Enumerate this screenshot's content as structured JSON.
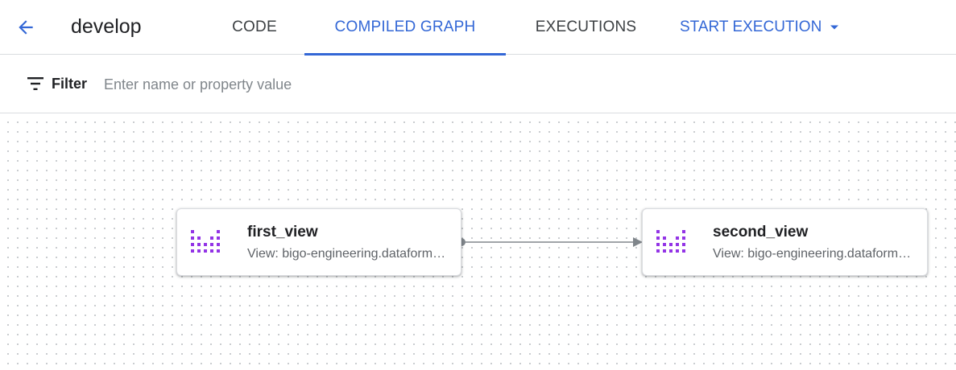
{
  "header": {
    "workspace_title": "develop",
    "tabs": [
      {
        "label": "CODE",
        "active": false
      },
      {
        "label": "COMPILED GRAPH",
        "active": true
      },
      {
        "label": "EXECUTIONS",
        "active": false
      }
    ],
    "start_execution_label": "START EXECUTION"
  },
  "filter": {
    "label": "Filter",
    "placeholder": "Enter name or property value",
    "value": ""
  },
  "graph": {
    "nodes": [
      {
        "name": "first_view",
        "subtitle": "View: bigo-engineering.dataform_staging.first_view",
        "icon": "view-table-icon"
      },
      {
        "name": "second_view",
        "subtitle": "View: bigo-engineering.dataform_staging.second_view",
        "icon": "view-table-icon"
      }
    ],
    "edges": [
      {
        "from": "first_view",
        "to": "second_view"
      }
    ]
  },
  "colors": {
    "accent": "#3367d6",
    "node_icon": "#9334e6",
    "edge": "#80868b",
    "border": "#dadce0"
  }
}
